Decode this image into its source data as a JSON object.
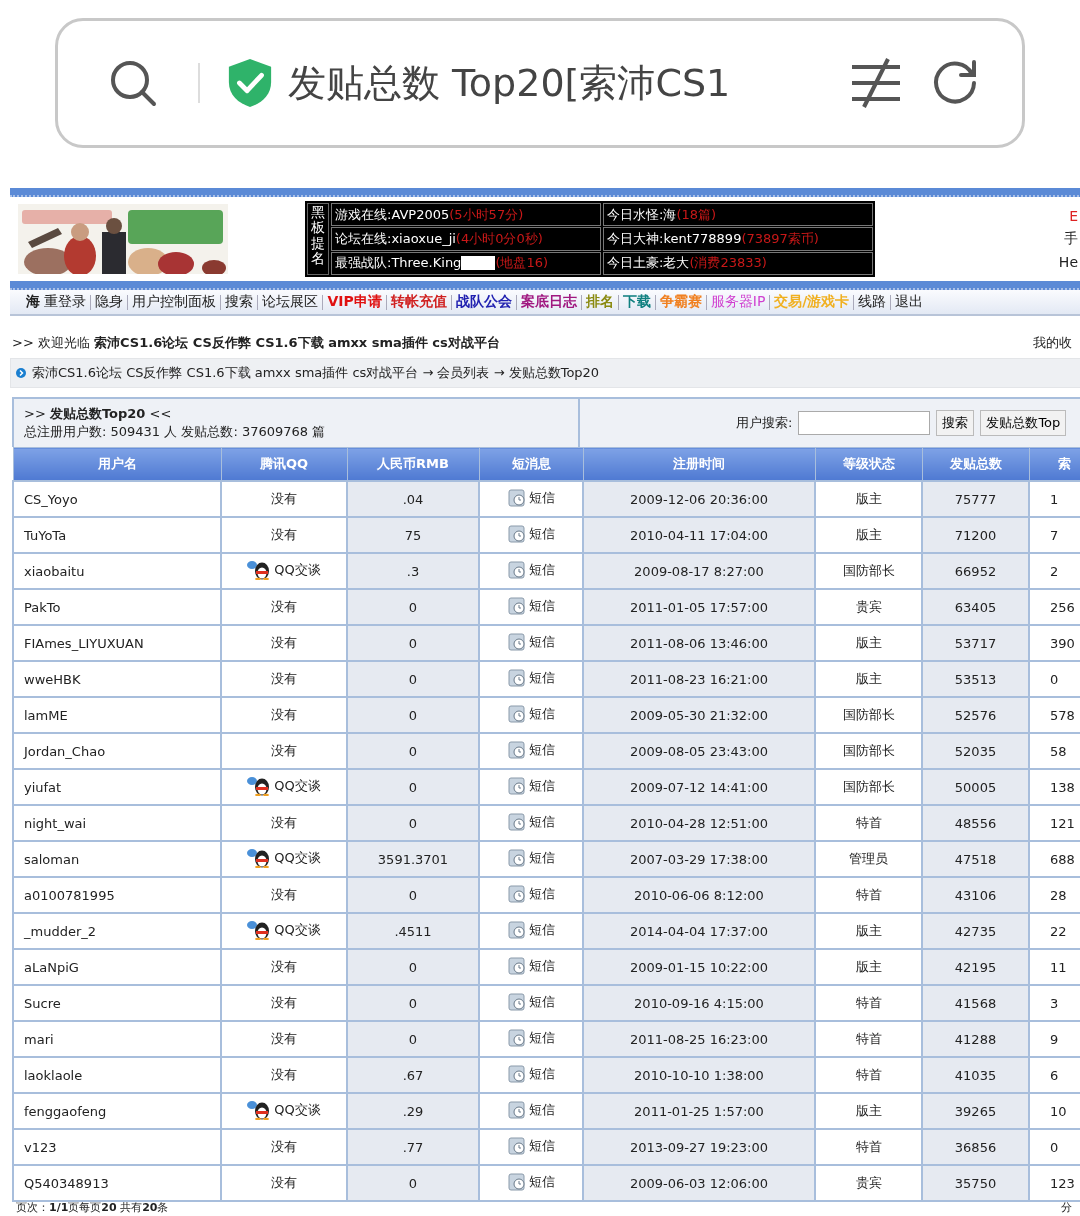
{
  "browser": {
    "title": "发贴总数 Top20[索沛CS1"
  },
  "header": {
    "board_label": "黑板提名",
    "board": [
      {
        "label": "游戏在线:AVP2005",
        "note": "(5小时57分)"
      },
      {
        "label": "今日水怪:海",
        "note": "(18篇)"
      },
      {
        "label": "论坛在线:xiaoxue_ji",
        "note": "(4小时0分0秒)"
      },
      {
        "label": "今日大神:kent778899",
        "note": "(73897索币)"
      },
      {
        "label": "最强战队:Three.King",
        "note": "(地盘16)",
        "redacted": true
      },
      {
        "label": "今日土豪:老大",
        "note": "(消费23833)"
      }
    ],
    "side": [
      {
        "text": "E",
        "color": "#dd2222"
      },
      {
        "text": "手",
        "color": "#222222"
      },
      {
        "text": "He",
        "color": "#222222"
      }
    ]
  },
  "nav": [
    {
      "label": "**海** 重登录",
      "bold": false
    },
    {
      "label": "隐身",
      "bold": false
    },
    {
      "label": "用户控制面板",
      "bold": false
    },
    {
      "label": "搜索",
      "bold": false
    },
    {
      "label": "论坛展区",
      "bold": false
    },
    {
      "label": "VIP申请",
      "color": "#e01010",
      "bold": true
    },
    {
      "label": "转帐充值",
      "color": "#d02020",
      "bold": true
    },
    {
      "label": "战队公会",
      "color": "#2020b0",
      "bold": true
    },
    {
      "label": "案底日志",
      "color": "#a01880",
      "bold": true
    },
    {
      "label": "排名",
      "color": "#8a8a10",
      "bold": true
    },
    {
      "label": "下载",
      "color": "#108080",
      "bold": true
    },
    {
      "label": "争霸赛",
      "color": "#f08020",
      "bold": true
    },
    {
      "label": "服务器IP",
      "color": "#d040d0",
      "bold": false
    },
    {
      "label": "交易/游戏卡",
      "color": "#f0b020",
      "bold": true
    },
    {
      "label": "线路",
      "bold": false
    },
    {
      "label": "退出",
      "bold": false
    }
  ],
  "welcome": ">> 欢迎光临 **索沛CS1.6论坛 CS反作弊 CS1.6下载 amxx sma插件 cs对战平台**",
  "welcome_right": "我的收",
  "breadcrumb": "索沛CS1.6论坛 CS反作弊 CS1.6下载 amxx sma插件 cs对战平台 → 会员列表 → 发贴总数Top20",
  "panel": {
    "title": ">> **发贴总数Top20** <<",
    "stats": "总注册用户数:  509431 人    发贴总数:  37609768 篇",
    "search_label": "用户搜索:",
    "search_button": "搜索",
    "top_button": "发贴总数Top"
  },
  "table": {
    "columns": [
      "用户名",
      "腾讯QQ",
      "人民币RMB",
      "短消息",
      "注册时间",
      "等级状态",
      "发贴总数",
      "索"
    ],
    "rows": [
      {
        "name": "CS_Yoyo",
        "qq": {
          "kind": "none",
          "text": "没有"
        },
        "rmb": ".04",
        "msg": "短信",
        "time": "2009-12-06 20:36:00",
        "level": "版主",
        "posts": "75777",
        "column_8": "1"
      },
      {
        "name": "TuYoTa",
        "qq": {
          "kind": "none",
          "text": "没有"
        },
        "rmb": "75",
        "msg": "短信",
        "time": "2010-04-11 17:04:00",
        "level": "版主",
        "posts": "71200",
        "column_8": "7"
      },
      {
        "name": "xiaobaitu",
        "qq": {
          "kind": "qq",
          "text": "QQ交谈"
        },
        "rmb": ".3",
        "msg": "短信",
        "time": "2009-08-17 8:27:00",
        "level": "国防部长",
        "posts": "66952",
        "column_8": "2"
      },
      {
        "name": "PakTo",
        "qq": {
          "kind": "none",
          "text": "没有"
        },
        "rmb": "0",
        "msg": "短信",
        "time": "2011-01-05 17:57:00",
        "level": "贵宾",
        "posts": "63405",
        "column_8": "256"
      },
      {
        "name": "FIAmes_LIYUXUAN",
        "qq": {
          "kind": "none",
          "text": "没有"
        },
        "rmb": "0",
        "msg": "短信",
        "time": "2011-08-06 13:46:00",
        "level": "版主",
        "posts": "53717",
        "column_8": "390"
      },
      {
        "name": "wweHBK",
        "qq": {
          "kind": "none",
          "text": "没有"
        },
        "rmb": "0",
        "msg": "短信",
        "time": "2011-08-23 16:21:00",
        "level": "版主",
        "posts": "53513",
        "column_8": "0"
      },
      {
        "name": "lamME",
        "qq": {
          "kind": "none",
          "text": "没有"
        },
        "rmb": "0",
        "msg": "短信",
        "time": "2009-05-30 21:32:00",
        "level": "国防部长",
        "posts": "52576",
        "column_8": "578"
      },
      {
        "name": "Jordan_Chao",
        "qq": {
          "kind": "none",
          "text": "没有"
        },
        "rmb": "0",
        "msg": "短信",
        "time": "2009-08-05 23:43:00",
        "level": "国防部长",
        "posts": "52035",
        "column_8": "58"
      },
      {
        "name": "yiufat",
        "qq": {
          "kind": "qq",
          "text": "QQ交谈"
        },
        "rmb": "0",
        "msg": "短信",
        "time": "2009-07-12 14:41:00",
        "level": "国防部长",
        "posts": "50005",
        "column_8": "138"
      },
      {
        "name": "night_wai",
        "qq": {
          "kind": "none",
          "text": "没有"
        },
        "rmb": "0",
        "msg": "短信",
        "time": "2010-04-28 12:51:00",
        "level": "特首",
        "posts": "48556",
        "column_8": "121"
      },
      {
        "name": "saloman",
        "qq": {
          "kind": "qq",
          "text": "QQ交谈"
        },
        "rmb": "3591.3701",
        "msg": "短信",
        "time": "2007-03-29 17:38:00",
        "level": "管理员",
        "posts": "47518",
        "column_8": "688"
      },
      {
        "name": "a0100781995",
        "qq": {
          "kind": "none",
          "text": "没有"
        },
        "rmb": "0",
        "msg": "短信",
        "time": "2010-06-06 8:12:00",
        "level": "特首",
        "posts": "43106",
        "column_8": "28"
      },
      {
        "name": "_mudder_2",
        "qq": {
          "kind": "qq",
          "text": "QQ交谈"
        },
        "rmb": ".4511",
        "msg": "短信",
        "time": "2014-04-04 17:37:00",
        "level": "版主",
        "posts": "42735",
        "column_8": "22"
      },
      {
        "name": "aLaNpiG",
        "qq": {
          "kind": "none",
          "text": "没有"
        },
        "rmb": "0",
        "msg": "短信",
        "time": "2009-01-15 10:22:00",
        "level": "版主",
        "posts": "42195",
        "column_8": "11"
      },
      {
        "name": "Sucre",
        "qq": {
          "kind": "none",
          "text": "没有"
        },
        "rmb": "0",
        "msg": "短信",
        "time": "2010-09-16 4:15:00",
        "level": "特首",
        "posts": "41568",
        "column_8": "3"
      },
      {
        "name": "mari",
        "qq": {
          "kind": "none",
          "text": "没有"
        },
        "rmb": "0",
        "msg": "短信",
        "time": "2011-08-25 16:23:00",
        "level": "特首",
        "posts": "41288",
        "column_8": "9"
      },
      {
        "name": "laoklaole",
        "qq": {
          "kind": "none",
          "text": "没有"
        },
        "rmb": ".67",
        "msg": "短信",
        "time": "2010-10-10 1:38:00",
        "level": "特首",
        "posts": "41035",
        "column_8": "6"
      },
      {
        "name": "fenggaofeng",
        "qq": {
          "kind": "qq",
          "text": "QQ交谈"
        },
        "rmb": ".29",
        "msg": "短信",
        "time": "2011-01-25 1:57:00",
        "level": "版主",
        "posts": "39265",
        "column_8": "10"
      },
      {
        "name": "v123",
        "qq": {
          "kind": "none",
          "text": "没有"
        },
        "rmb": ".77",
        "msg": "短信",
        "time": "2013-09-27 19:23:00",
        "level": "特首",
        "posts": "36856",
        "column_8": "0"
      },
      {
        "name": "Q540348913",
        "qq": {
          "kind": "none",
          "text": "没有"
        },
        "rmb": "0",
        "msg": "短信",
        "time": "2009-06-03 12:06:00",
        "level": "贵宾",
        "posts": "35750",
        "column_8": "123"
      }
    ]
  },
  "footer": "页次：**1/1**页每页**20** 共有**20**条",
  "footer_right": "分"
}
